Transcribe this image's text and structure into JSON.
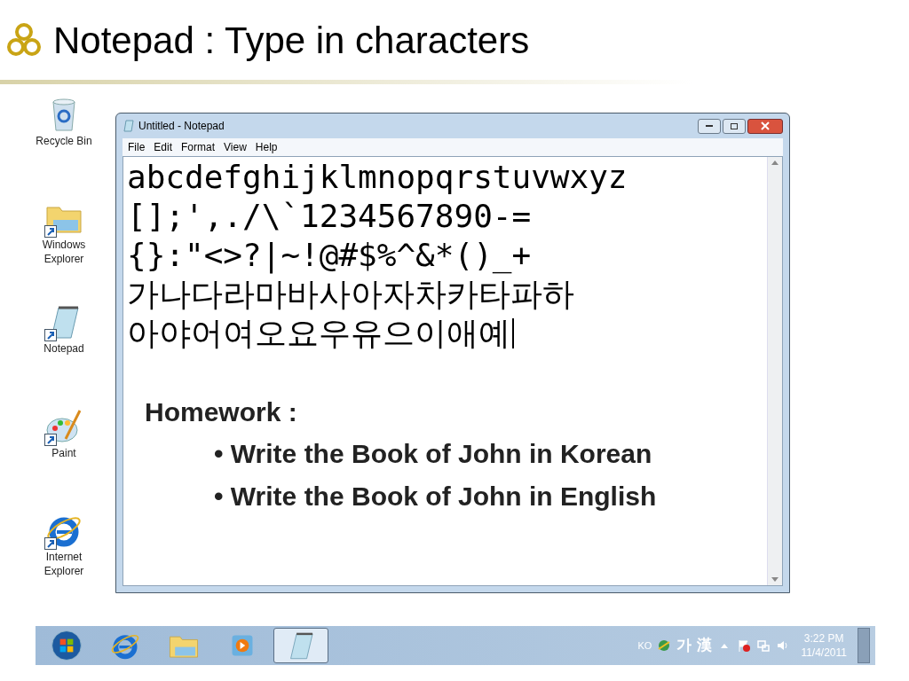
{
  "title": "Notepad : Type in characters",
  "desktop_icons": [
    {
      "kind": "recycle",
      "label": "Recycle Bin"
    },
    {
      "kind": "folder",
      "label": "Windows Explorer"
    },
    {
      "kind": "notepad",
      "label": "Notepad"
    },
    {
      "kind": "paint",
      "label": "Paint"
    },
    {
      "kind": "ie",
      "label": "Internet Explorer"
    }
  ],
  "notepad": {
    "title": "Untitled - Notepad",
    "menu": [
      "File",
      "Edit",
      "Format",
      "View",
      "Help"
    ],
    "lines": [
      "abcdefghijklmnopqrstuvwxyz",
      "[];',./\\`1234567890-=",
      "{}:\"<>?|~!@#$%^&*()_+",
      "가나다라마바사아자차카타파하",
      "아야어여오요우유으이애예"
    ]
  },
  "homework": {
    "heading": "Homework :",
    "items": [
      "• Write the Book of John in Korean",
      "• Write the Book of John in English"
    ]
  },
  "taskbar": {
    "apps": [
      {
        "kind": "start",
        "selected": false
      },
      {
        "kind": "ie",
        "selected": false
      },
      {
        "kind": "folder",
        "selected": false
      },
      {
        "kind": "media",
        "selected": false
      },
      {
        "kind": "notepad",
        "selected": true
      }
    ],
    "language": "KO",
    "ime": [
      "가",
      "漢"
    ],
    "time": "3:22 PM",
    "date": "11/4/2011"
  }
}
